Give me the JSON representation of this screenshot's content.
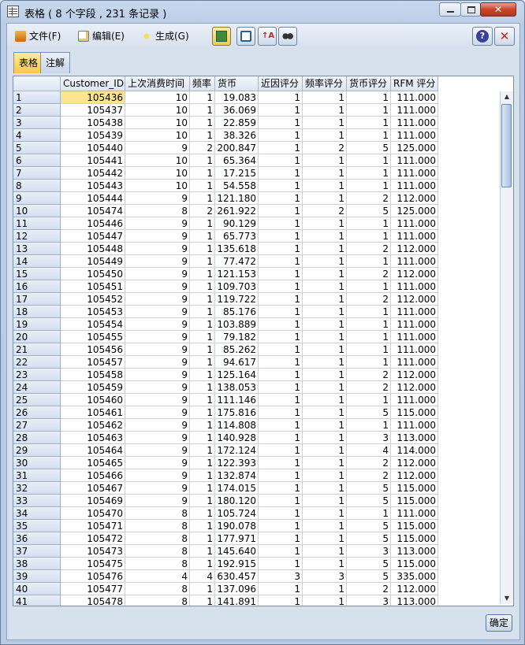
{
  "window": {
    "title": "表格 ( 8 个字段 , 231 条记录 )",
    "close_label": "✕"
  },
  "menu": {
    "file": "文件(F)",
    "edit": "编辑(E)",
    "generate": "生成(G)"
  },
  "toolbar_icons": [
    "copy-table-icon",
    "print-icon",
    "sort-icon",
    "find-icon"
  ],
  "help": {
    "label": "?"
  },
  "close_x": {
    "label": "✕"
  },
  "tabs": {
    "table": "表格",
    "notes": "注解"
  },
  "table": {
    "columns": [
      "Customer_ID",
      "上次消费时间",
      "频率",
      "货币",
      "近因评分",
      "频率评分",
      "货币评分",
      "RFM 评分"
    ],
    "rows": [
      [
        "1",
        "105436",
        "10",
        "1",
        "19.083",
        "1",
        "1",
        "1",
        "111.000"
      ],
      [
        "2",
        "105437",
        "10",
        "1",
        "36.069",
        "1",
        "1",
        "1",
        "111.000"
      ],
      [
        "3",
        "105438",
        "10",
        "1",
        "22.859",
        "1",
        "1",
        "1",
        "111.000"
      ],
      [
        "4",
        "105439",
        "10",
        "1",
        "38.326",
        "1",
        "1",
        "1",
        "111.000"
      ],
      [
        "5",
        "105440",
        "9",
        "2",
        "200.847",
        "1",
        "2",
        "5",
        "125.000"
      ],
      [
        "6",
        "105441",
        "10",
        "1",
        "65.364",
        "1",
        "1",
        "1",
        "111.000"
      ],
      [
        "7",
        "105442",
        "10",
        "1",
        "17.215",
        "1",
        "1",
        "1",
        "111.000"
      ],
      [
        "8",
        "105443",
        "10",
        "1",
        "54.558",
        "1",
        "1",
        "1",
        "111.000"
      ],
      [
        "9",
        "105444",
        "9",
        "1",
        "121.180",
        "1",
        "1",
        "2",
        "112.000"
      ],
      [
        "10",
        "105474",
        "8",
        "2",
        "261.922",
        "1",
        "2",
        "5",
        "125.000"
      ],
      [
        "11",
        "105446",
        "9",
        "1",
        "90.129",
        "1",
        "1",
        "1",
        "111.000"
      ],
      [
        "12",
        "105447",
        "9",
        "1",
        "65.773",
        "1",
        "1",
        "1",
        "111.000"
      ],
      [
        "13",
        "105448",
        "9",
        "1",
        "135.618",
        "1",
        "1",
        "2",
        "112.000"
      ],
      [
        "14",
        "105449",
        "9",
        "1",
        "77.472",
        "1",
        "1",
        "1",
        "111.000"
      ],
      [
        "15",
        "105450",
        "9",
        "1",
        "121.153",
        "1",
        "1",
        "2",
        "112.000"
      ],
      [
        "16",
        "105451",
        "9",
        "1",
        "109.703",
        "1",
        "1",
        "1",
        "111.000"
      ],
      [
        "17",
        "105452",
        "9",
        "1",
        "119.722",
        "1",
        "1",
        "2",
        "112.000"
      ],
      [
        "18",
        "105453",
        "9",
        "1",
        "85.176",
        "1",
        "1",
        "1",
        "111.000"
      ],
      [
        "19",
        "105454",
        "9",
        "1",
        "103.889",
        "1",
        "1",
        "1",
        "111.000"
      ],
      [
        "20",
        "105455",
        "9",
        "1",
        "79.182",
        "1",
        "1",
        "1",
        "111.000"
      ],
      [
        "21",
        "105456",
        "9",
        "1",
        "85.262",
        "1",
        "1",
        "1",
        "111.000"
      ],
      [
        "22",
        "105457",
        "9",
        "1",
        "94.617",
        "1",
        "1",
        "1",
        "111.000"
      ],
      [
        "23",
        "105458",
        "9",
        "1",
        "125.164",
        "1",
        "1",
        "2",
        "112.000"
      ],
      [
        "24",
        "105459",
        "9",
        "1",
        "138.053",
        "1",
        "1",
        "2",
        "112.000"
      ],
      [
        "25",
        "105460",
        "9",
        "1",
        "111.146",
        "1",
        "1",
        "1",
        "111.000"
      ],
      [
        "26",
        "105461",
        "9",
        "1",
        "175.816",
        "1",
        "1",
        "5",
        "115.000"
      ],
      [
        "27",
        "105462",
        "9",
        "1",
        "114.808",
        "1",
        "1",
        "1",
        "111.000"
      ],
      [
        "28",
        "105463",
        "9",
        "1",
        "140.928",
        "1",
        "1",
        "3",
        "113.000"
      ],
      [
        "29",
        "105464",
        "9",
        "1",
        "172.124",
        "1",
        "1",
        "4",
        "114.000"
      ],
      [
        "30",
        "105465",
        "9",
        "1",
        "122.393",
        "1",
        "1",
        "2",
        "112.000"
      ],
      [
        "31",
        "105466",
        "9",
        "1",
        "132.874",
        "1",
        "1",
        "2",
        "112.000"
      ],
      [
        "32",
        "105467",
        "9",
        "1",
        "174.015",
        "1",
        "1",
        "5",
        "115.000"
      ],
      [
        "33",
        "105469",
        "9",
        "1",
        "180.120",
        "1",
        "1",
        "5",
        "115.000"
      ],
      [
        "34",
        "105470",
        "8",
        "1",
        "105.724",
        "1",
        "1",
        "1",
        "111.000"
      ],
      [
        "35",
        "105471",
        "8",
        "1",
        "190.078",
        "1",
        "1",
        "5",
        "115.000"
      ],
      [
        "36",
        "105472",
        "8",
        "1",
        "177.971",
        "1",
        "1",
        "5",
        "115.000"
      ],
      [
        "37",
        "105473",
        "8",
        "1",
        "145.640",
        "1",
        "1",
        "3",
        "113.000"
      ],
      [
        "38",
        "105475",
        "8",
        "1",
        "192.915",
        "1",
        "1",
        "5",
        "115.000"
      ],
      [
        "39",
        "105476",
        "4",
        "4",
        "630.457",
        "3",
        "3",
        "5",
        "335.000"
      ],
      [
        "40",
        "105477",
        "8",
        "1",
        "137.096",
        "1",
        "1",
        "2",
        "112.000"
      ],
      [
        "41",
        "105478",
        "8",
        "1",
        "141.891",
        "1",
        "1",
        "3",
        "113.000"
      ]
    ]
  },
  "scrollbar": {
    "up": "▲",
    "down": "▼"
  },
  "ok": {
    "label": "确定"
  }
}
